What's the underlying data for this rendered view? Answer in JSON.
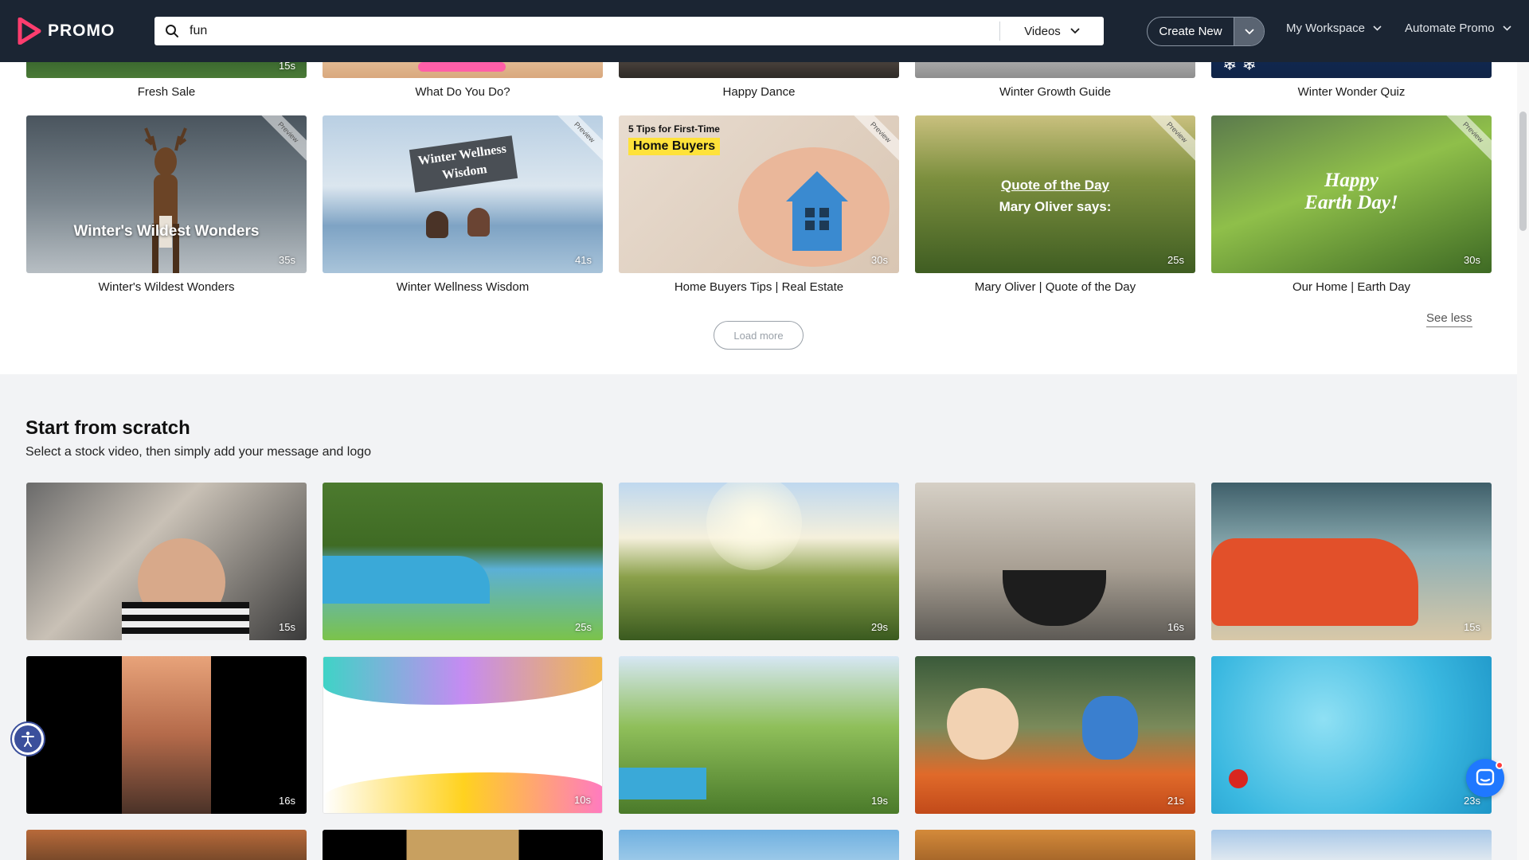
{
  "nav": {
    "brand": "PROMO",
    "search_value": "fun",
    "search_type": "Videos",
    "create_new": "Create New",
    "workspace": "My Workspace",
    "automate": "Automate Promo"
  },
  "top_row_captions": [
    "Fresh Sale",
    "What Do You Do?",
    "Happy Dance",
    "Winter Growth Guide",
    "Winter Wonder Quiz"
  ],
  "templates": [
    {
      "title": "Winter's Wildest Wonders",
      "duration": "35s",
      "overlay": "Winter's Wildest Wonders",
      "ribbon": "Preview"
    },
    {
      "title": "Winter Wellness Wisdom",
      "duration": "41s",
      "overlay": "Winter Wellness Wisdom",
      "ribbon": "Preview"
    },
    {
      "title": "Home Buyers Tips | Real Estate",
      "duration": "30s",
      "overlay_small": "5 Tips for First-Time",
      "overlay_big": "Home Buyers",
      "ribbon": "Preview"
    },
    {
      "title": "Mary Oliver | Quote of the Day",
      "duration": "25s",
      "overlay_line1": "Quote of the Day",
      "overlay_line2": "Mary Oliver says:",
      "ribbon": "Preview"
    },
    {
      "title": "Our Home | Earth Day",
      "duration": "30s",
      "overlay_line1": "Happy",
      "overlay_line2": "Earth Day!",
      "ribbon": "Preview"
    }
  ],
  "see_less": "See less",
  "load_more": "Load more",
  "scratch": {
    "title": "Start from scratch",
    "subtitle": "Select a stock video, then simply add your message and logo",
    "row1_durations": [
      "15s",
      "25s",
      "29s",
      "16s",
      "15s"
    ],
    "row2_durations": [
      "16s",
      "10s",
      "19s",
      "21s",
      "23s"
    ]
  },
  "colors": {
    "nav_bg": "#1b2533",
    "brand_accent": "#ff3d6e",
    "chat_blue": "#1f78ff",
    "access_blue": "#3b4f9c"
  }
}
